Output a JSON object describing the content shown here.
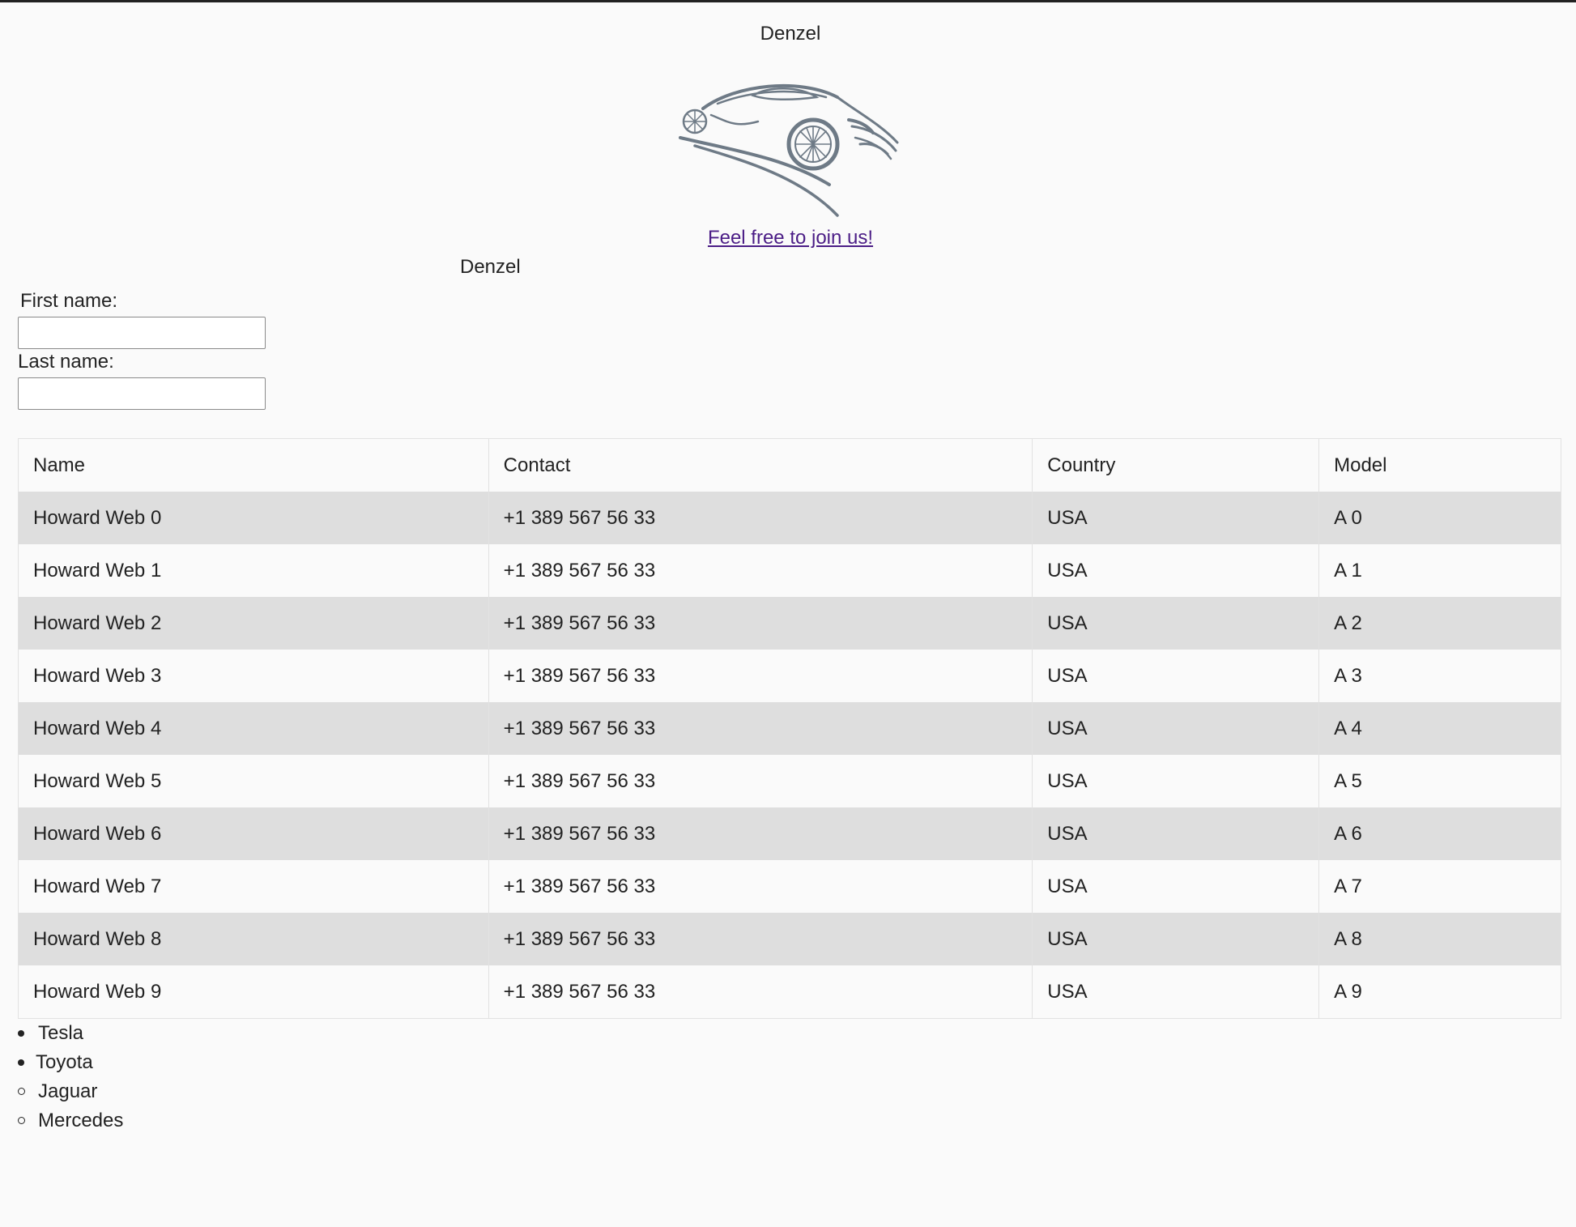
{
  "header": {
    "title": "Denzel",
    "logo_icon": "sports-car-logo",
    "join_link": "Feel free to join us!"
  },
  "form": {
    "title": "Denzel",
    "first_name_label": "First name:",
    "first_name_value": "",
    "last_name_label": "Last name:",
    "last_name_value": ""
  },
  "table": {
    "headers": [
      "Name",
      "Contact",
      "Country",
      "Model"
    ],
    "rows": [
      [
        "Howard Web 0",
        "+1 389 567 56 33",
        "USA",
        "A 0"
      ],
      [
        "Howard Web 1",
        "+1 389 567 56 33",
        "USA",
        "A 1"
      ],
      [
        "Howard Web 2",
        "+1 389 567 56 33",
        "USA",
        "A 2"
      ],
      [
        "Howard Web 3",
        "+1 389 567 56 33",
        "USA",
        "A 3"
      ],
      [
        "Howard Web 4",
        "+1 389 567 56 33",
        "USA",
        "A 4"
      ],
      [
        "Howard Web 5",
        "+1 389 567 56 33",
        "USA",
        "A 5"
      ],
      [
        "Howard Web 6",
        "+1 389 567 56 33",
        "USA",
        "A 6"
      ],
      [
        "Howard Web 7",
        "+1 389 567 56 33",
        "USA",
        "A 7"
      ],
      [
        "Howard Web 8",
        "+1 389 567 56 33",
        "USA",
        "A 8"
      ],
      [
        "Howard Web 9",
        "+1 389 567 56 33",
        "USA",
        "A 9"
      ]
    ]
  },
  "brands": [
    "Tesla",
    "Toyota",
    "Jaguar",
    "Mercedes"
  ]
}
